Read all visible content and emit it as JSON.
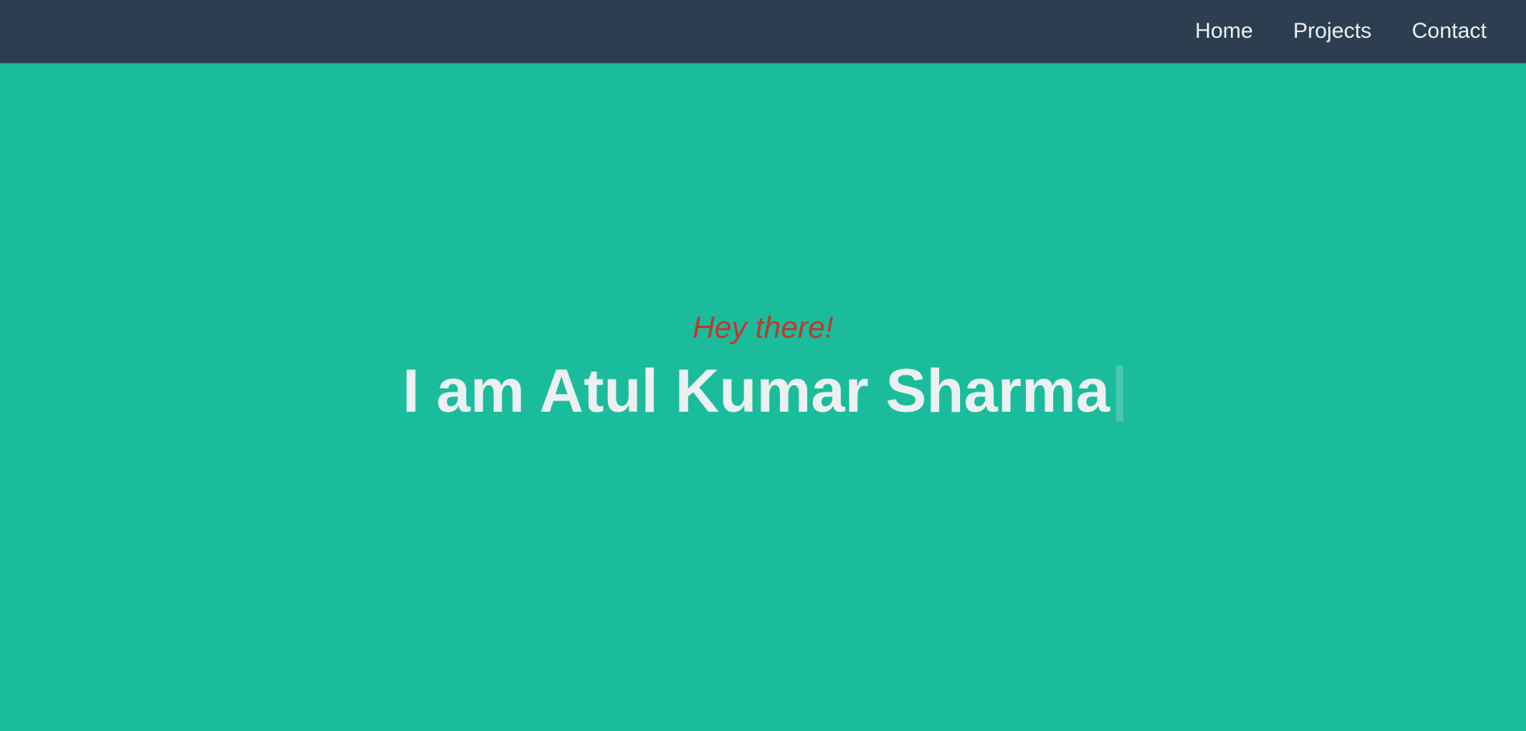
{
  "nav": {
    "items": [
      {
        "label": "Home"
      },
      {
        "label": "Projects"
      },
      {
        "label": "Contact"
      }
    ]
  },
  "hero": {
    "greeting": "Hey there!",
    "headline": "I am Atul Kumar Sharma"
  },
  "colors": {
    "navbar_bg": "#2c3e50",
    "hero_bg": "#1abc9c",
    "greeting": "#c0392b",
    "headline": "#ecf0f1",
    "nav_text": "#ecf0f1"
  }
}
